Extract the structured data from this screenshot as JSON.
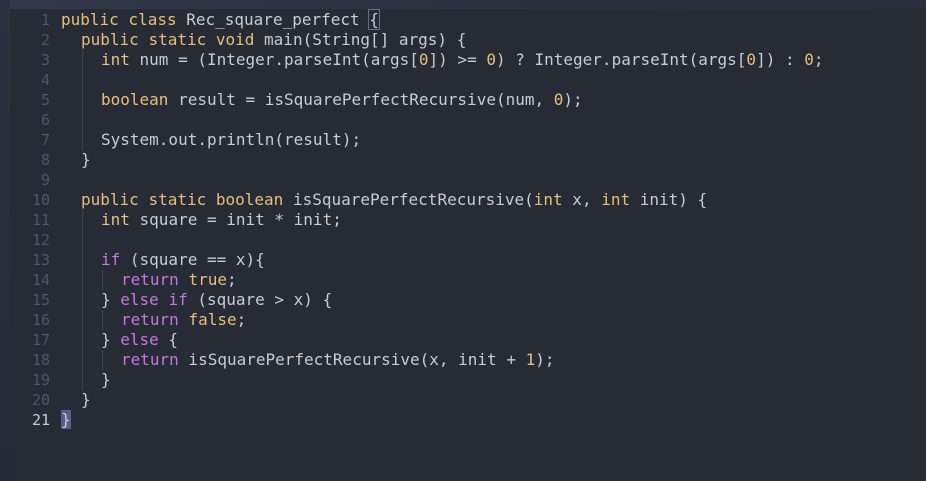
{
  "editor": {
    "active_line": 21,
    "lines": [
      {
        "n": "1",
        "indent": 0,
        "tokens": [
          [
            "kwy",
            "public"
          ],
          [
            "pl",
            " "
          ],
          [
            "kwy",
            "class"
          ],
          [
            "pl",
            " Rec_square_perfect "
          ],
          [
            "brace-outline",
            "{"
          ]
        ]
      },
      {
        "n": "2",
        "indent": 1,
        "tokens": [
          [
            "kwy",
            "public"
          ],
          [
            "pl",
            " "
          ],
          [
            "kwy",
            "static"
          ],
          [
            "pl",
            " "
          ],
          [
            "kwy",
            "void"
          ],
          [
            "pl",
            " main(String[] args) {"
          ]
        ]
      },
      {
        "n": "3",
        "indent": 2,
        "tokens": [
          [
            "kwy",
            "int"
          ],
          [
            "pl",
            " num = (Integer.parseInt(args["
          ],
          [
            "num",
            "0"
          ],
          [
            "pl",
            "]) >= "
          ],
          [
            "num",
            "0"
          ],
          [
            "pl",
            ") ? Integer.parseInt(args["
          ],
          [
            "num",
            "0"
          ],
          [
            "pl",
            "]) : "
          ],
          [
            "num",
            "0"
          ],
          [
            "pl",
            ";"
          ]
        ]
      },
      {
        "n": "4",
        "indent": 2,
        "tokens": []
      },
      {
        "n": "5",
        "indent": 2,
        "tokens": [
          [
            "kwy",
            "boolean"
          ],
          [
            "pl",
            " result = isSquarePerfectRecursive(num, "
          ],
          [
            "num",
            "0"
          ],
          [
            "pl",
            ");"
          ]
        ]
      },
      {
        "n": "6",
        "indent": 2,
        "tokens": []
      },
      {
        "n": "7",
        "indent": 2,
        "tokens": [
          [
            "pl",
            "System.out.println(result);"
          ]
        ]
      },
      {
        "n": "8",
        "indent": 1,
        "tokens": [
          [
            "pl",
            "}"
          ]
        ]
      },
      {
        "n": "9",
        "indent": 1,
        "tokens": []
      },
      {
        "n": "10",
        "indent": 1,
        "tokens": [
          [
            "kwy",
            "public"
          ],
          [
            "pl",
            " "
          ],
          [
            "kwy",
            "static"
          ],
          [
            "pl",
            " "
          ],
          [
            "kwy",
            "boolean"
          ],
          [
            "pl",
            " isSquarePerfectRecursive("
          ],
          [
            "kwy",
            "int"
          ],
          [
            "pl",
            " x, "
          ],
          [
            "kwy",
            "int"
          ],
          [
            "pl",
            " init) {"
          ]
        ]
      },
      {
        "n": "11",
        "indent": 2,
        "tokens": [
          [
            "kwy",
            "int"
          ],
          [
            "pl",
            " square = init * init;"
          ]
        ]
      },
      {
        "n": "12",
        "indent": 2,
        "tokens": []
      },
      {
        "n": "13",
        "indent": 2,
        "tokens": [
          [
            "kw",
            "if"
          ],
          [
            "pl",
            " (square == x){"
          ]
        ]
      },
      {
        "n": "14",
        "indent": 3,
        "tokens": [
          [
            "kw",
            "return"
          ],
          [
            "pl",
            " "
          ],
          [
            "bool",
            "true"
          ],
          [
            "pl",
            ";"
          ]
        ]
      },
      {
        "n": "15",
        "indent": 2,
        "tokens": [
          [
            "pl",
            "} "
          ],
          [
            "kw",
            "else"
          ],
          [
            "pl",
            " "
          ],
          [
            "kw",
            "if"
          ],
          [
            "pl",
            " (square > x) {"
          ]
        ]
      },
      {
        "n": "16",
        "indent": 3,
        "tokens": [
          [
            "kw",
            "return"
          ],
          [
            "pl",
            " "
          ],
          [
            "bool",
            "false"
          ],
          [
            "pl",
            ";"
          ]
        ]
      },
      {
        "n": "17",
        "indent": 2,
        "tokens": [
          [
            "pl",
            "} "
          ],
          [
            "kw",
            "else"
          ],
          [
            "pl",
            " {"
          ]
        ]
      },
      {
        "n": "18",
        "indent": 3,
        "tokens": [
          [
            "kw",
            "return"
          ],
          [
            "pl",
            " isSquarePerfectRecursive(x, init + "
          ],
          [
            "num",
            "1"
          ],
          [
            "pl",
            ");"
          ]
        ]
      },
      {
        "n": "19",
        "indent": 2,
        "tokens": [
          [
            "pl",
            "}"
          ]
        ]
      },
      {
        "n": "20",
        "indent": 1,
        "tokens": [
          [
            "pl",
            "}"
          ]
        ]
      },
      {
        "n": "21",
        "indent": 0,
        "tokens": [
          [
            "brace-hl",
            "}"
          ]
        ]
      }
    ]
  },
  "colors": {
    "background": "#262b35",
    "keyword_yellow": "#e5c07b",
    "keyword_purple": "#c678dd",
    "text": "#c8ccd4",
    "line_number": "#4f5666"
  }
}
